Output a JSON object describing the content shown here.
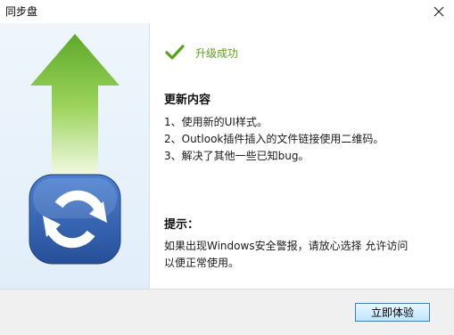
{
  "window": {
    "title": "同步盘"
  },
  "status": {
    "text": "升级成功",
    "icon": "check-icon",
    "color": "#5aa218"
  },
  "release_notes": {
    "title": "更新内容",
    "items": [
      "1、使用新的UI样式。",
      "2、Outlook插件插入的文件链接使用二维码。",
      "3、解决了其他一些已知bug。"
    ]
  },
  "hint": {
    "title": "提示：",
    "lines": [
      "如果出现Windows安全警报，请放心选择 允许访问",
      "以便正常使用。"
    ]
  },
  "footer": {
    "button_label": "立即体验"
  },
  "colors": {
    "accent_green": "#5aa218",
    "arrow_green": "#7cc23a",
    "logo_blue": "#3867b3"
  }
}
